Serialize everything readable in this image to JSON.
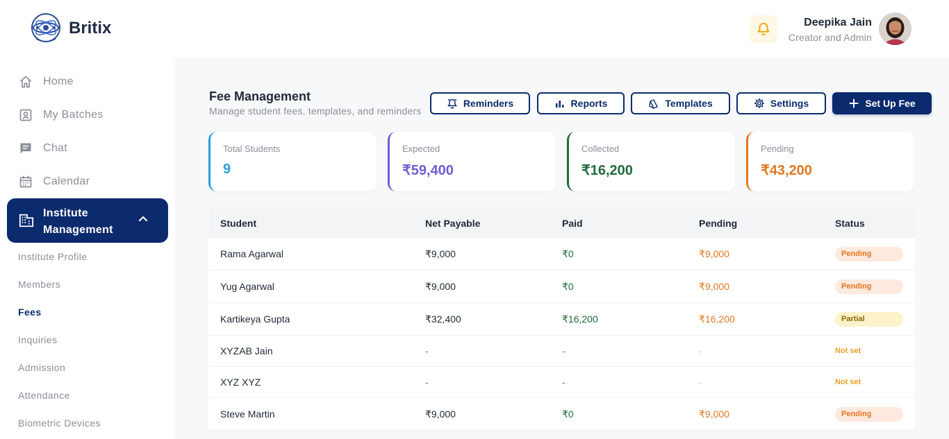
{
  "brand": {
    "name": "Britix"
  },
  "user": {
    "name": "Deepika Jain",
    "role": "Creator and Admin"
  },
  "sidebar": {
    "items": [
      {
        "label": "Home",
        "icon": "home-icon"
      },
      {
        "label": "My Batches",
        "icon": "batches-icon"
      },
      {
        "label": "Chat",
        "icon": "chat-icon"
      },
      {
        "label": "Calendar",
        "icon": "calendar-icon"
      }
    ],
    "active": {
      "label_line1": "Institute",
      "label_line2": "Management",
      "icon": "building-icon"
    },
    "subitems": [
      {
        "label": "Institute Profile"
      },
      {
        "label": "Members"
      },
      {
        "label": "Fees"
      },
      {
        "label": "Inquiries"
      },
      {
        "label": "Admission"
      },
      {
        "label": "Attendance"
      },
      {
        "label": "Biometric Devices"
      }
    ]
  },
  "page": {
    "title": "Fee Management",
    "subtitle": "Manage student fees, templates, and reminders"
  },
  "buttons": {
    "reminders": "Reminders",
    "reports": "Reports",
    "templates": "Templates",
    "settings": "Settings",
    "setup": "Set Up Fee"
  },
  "stats": [
    {
      "label": "Total Students",
      "value": "9",
      "color": "#2a9fd8"
    },
    {
      "label": "Expected",
      "value": "₹59,400",
      "color": "#6c5fd3"
    },
    {
      "label": "Collected",
      "value": "₹16,200",
      "color": "#1f6b3a"
    },
    {
      "label": "Pending",
      "value": "₹43,200",
      "color": "#e0781f"
    }
  ],
  "table": {
    "headers": [
      "Student",
      "Net Payable",
      "Paid",
      "Pending",
      "Status"
    ],
    "rows": [
      {
        "student": "Rama Agarwal",
        "net": "₹9,000",
        "paid": "₹0",
        "pending": "₹9,000",
        "status": "Pending"
      },
      {
        "student": "Yug Agarwal",
        "net": "₹9,000",
        "paid": "₹0",
        "pending": "₹9,000",
        "status": "Pending"
      },
      {
        "student": "Kartikeya Gupta",
        "net": "₹32,400",
        "paid": "₹16,200",
        "pending": "₹16,200",
        "status": "Partial"
      },
      {
        "student": "XYZAB Jain",
        "net": "-",
        "paid": "-",
        "pending": "-",
        "status": "Not set"
      },
      {
        "student": "XYZ XYZ",
        "net": "-",
        "paid": "-",
        "pending": "-",
        "status": "Not set"
      },
      {
        "student": "Steve Martin",
        "net": "₹9,000",
        "paid": "₹0",
        "pending": "₹9,000",
        "status": "Pending"
      }
    ]
  },
  "colors": {
    "primary": "#0c2a6e",
    "collected": "#1f6b3a",
    "pending": "#e0781f",
    "expected": "#6c5fd3",
    "total": "#2a9fd8"
  }
}
